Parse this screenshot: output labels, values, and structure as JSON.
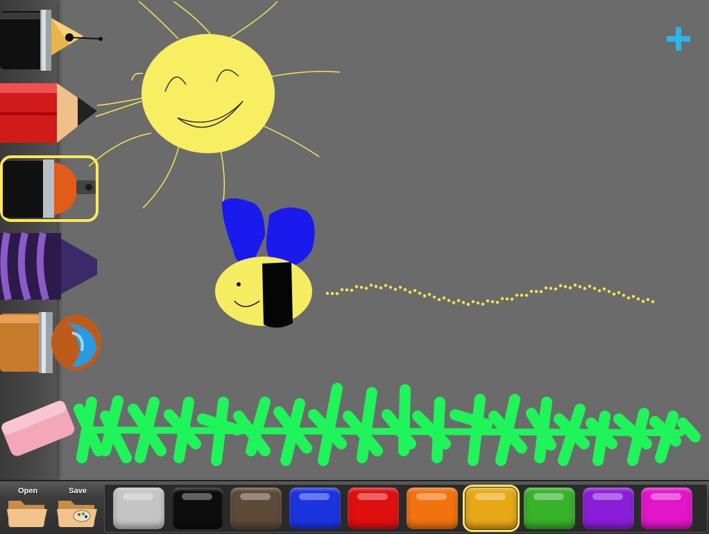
{
  "tools": [
    {
      "name": "pen",
      "icon": "fountain-pen-icon"
    },
    {
      "name": "pencil",
      "icon": "pencil-icon"
    },
    {
      "name": "spray",
      "icon": "spray-can-icon",
      "selected": true
    },
    {
      "name": "crayon",
      "icon": "crayon-icon"
    },
    {
      "name": "paint-brush",
      "icon": "paint-brush-icon"
    },
    {
      "name": "eraser",
      "icon": "eraser-icon"
    }
  ],
  "file_buttons": {
    "open_label": "Open",
    "save_label": "Save"
  },
  "palette": [
    {
      "name": "gray",
      "color": "#c4c4c4"
    },
    {
      "name": "black",
      "color": "#0d0d0d"
    },
    {
      "name": "brown",
      "color": "#5e4a38"
    },
    {
      "name": "blue",
      "color": "#1c33e0"
    },
    {
      "name": "red",
      "color": "#e01010"
    },
    {
      "name": "orange",
      "color": "#f2720f"
    },
    {
      "name": "yellow",
      "color": "#e8a816",
      "selected": true
    },
    {
      "name": "green",
      "color": "#38b22a"
    },
    {
      "name": "purple",
      "color": "#8a1ed8"
    },
    {
      "name": "magenta",
      "color": "#e016c8"
    }
  ],
  "colors": {
    "canvas_bg": "#6b6b6b",
    "accent_plus": "#2ab6ec",
    "selection_outline": "#ffe95a"
  }
}
